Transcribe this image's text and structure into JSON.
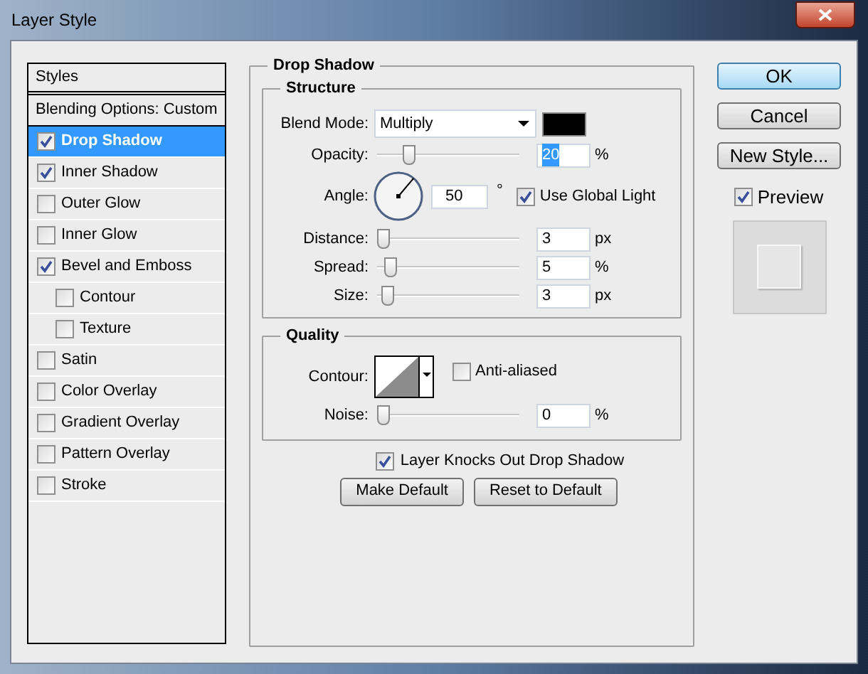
{
  "window": {
    "title": "Layer Style"
  },
  "styles_panel": {
    "header": "Styles",
    "blending_options": "Blending Options: Custom",
    "items": [
      {
        "label": "Drop Shadow",
        "checked": true,
        "selected": true
      },
      {
        "label": "Inner Shadow",
        "checked": true,
        "selected": false
      },
      {
        "label": "Outer Glow",
        "checked": false,
        "selected": false
      },
      {
        "label": "Inner Glow",
        "checked": false,
        "selected": false
      },
      {
        "label": "Bevel and Emboss",
        "checked": true,
        "selected": false,
        "children": [
          {
            "label": "Contour",
            "checked": false,
            "selected": false
          },
          {
            "label": "Texture",
            "checked": false,
            "selected": false
          }
        ]
      },
      {
        "label": "Satin",
        "checked": false,
        "selected": false
      },
      {
        "label": "Color Overlay",
        "checked": false,
        "selected": false
      },
      {
        "label": "Gradient Overlay",
        "checked": false,
        "selected": false
      },
      {
        "label": "Pattern Overlay",
        "checked": false,
        "selected": false
      },
      {
        "label": "Stroke",
        "checked": false,
        "selected": false
      }
    ]
  },
  "drop_shadow": {
    "title": "Drop Shadow",
    "structure": {
      "title": "Structure",
      "blend_mode": {
        "label": "Blend Mode:",
        "value": "Multiply",
        "color": "#000000"
      },
      "opacity": {
        "label": "Opacity:",
        "level": 0.2,
        "value": "20",
        "unit": "%",
        "text_selected": true
      },
      "angle": {
        "label": "Angle:",
        "value": "50",
        "unit": "°",
        "use_global_light": {
          "label": "Use Global Light",
          "checked": true
        }
      },
      "sliders": [
        {
          "label": "Distance:",
          "level": 0,
          "value": "3",
          "unit": "px"
        },
        {
          "label": "Spread:",
          "level": 0.05,
          "value": "5",
          "unit": "%"
        },
        {
          "label": "Size:",
          "level": 0.03,
          "value": "3",
          "unit": "px"
        }
      ]
    },
    "quality": {
      "title": "Quality",
      "contour_label": "Contour:",
      "anti_aliased": {
        "label": "Anti-aliased",
        "checked": false
      },
      "noise": {
        "label": "Noise:",
        "level": 0,
        "value": "0",
        "unit": "%"
      }
    },
    "knockout": {
      "label": "Layer Knocks Out Drop Shadow",
      "checked": true
    },
    "buttons": [
      "Make Default",
      "Reset to Default"
    ]
  },
  "actions": [
    {
      "label": "OK",
      "default": true
    },
    {
      "label": "Cancel",
      "default": false
    },
    {
      "label": "New Style...",
      "default": false
    }
  ],
  "preview": {
    "label": "Preview",
    "checked": true
  }
}
